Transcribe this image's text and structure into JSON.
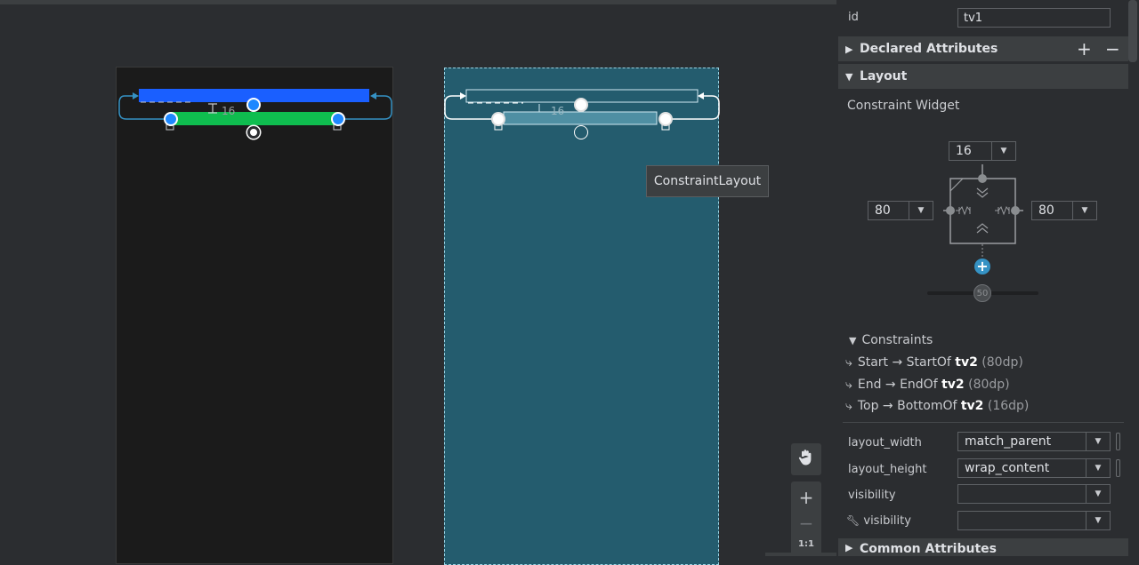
{
  "tooltip": {
    "text": "ConstraintLayout"
  },
  "design": {
    "margin_label": "16"
  },
  "blueprint": {
    "margin_label": "16"
  },
  "tools": {
    "zoom_in": "+",
    "zoom_out": "−",
    "one_to_one": "1:1"
  },
  "panel": {
    "id_label": "id",
    "id_value": "tv1",
    "declared_attributes": "Declared Attributes",
    "add": "+",
    "remove": "−",
    "layout_section": "Layout",
    "constraint_widget_title": "Constraint Widget",
    "top_margin": "16",
    "left_margin": "80",
    "right_margin": "80",
    "bias": "50",
    "constraints_title": "Constraints",
    "constraints": [
      {
        "prefix": "Start → StartOf ",
        "target": "tv2",
        "dim": " (80dp)"
      },
      {
        "prefix": "End → EndOf ",
        "target": "tv2",
        "dim": " (80dp)"
      },
      {
        "prefix": "Top → BottomOf ",
        "target": "tv2",
        "dim": " (16dp)"
      }
    ],
    "attributes": [
      {
        "label": "layout_width",
        "value": "match_parent"
      },
      {
        "label": "layout_height",
        "value": "wrap_content"
      },
      {
        "label": "visibility",
        "value": ""
      },
      {
        "label": "visibility",
        "value": ""
      }
    ],
    "common_attributes": "Common Attributes"
  },
  "colors": {
    "accent_blue": "#1e88ff",
    "green_widget": "#0fbd4f",
    "blue_widget": "#1a5fff",
    "blueprint_bg": "#245c6e",
    "plus_icon": "#3592c4"
  }
}
